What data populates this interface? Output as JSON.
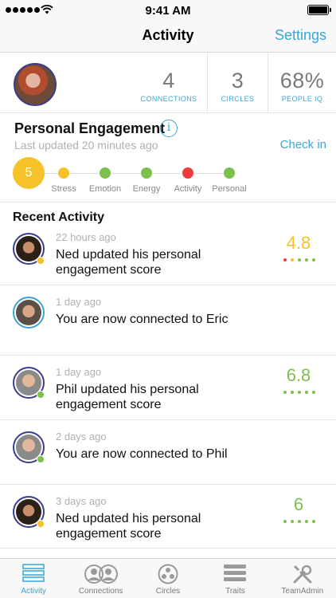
{
  "status_bar": {
    "time": "9:41 AM"
  },
  "nav": {
    "title": "Activity",
    "settings_label": "Settings"
  },
  "stats": [
    {
      "value": "4",
      "label": "CONNECTIONS"
    },
    {
      "value": "3",
      "label": "CIRCLES"
    },
    {
      "value": "68%",
      "label": "PEOPLE IQ"
    }
  ],
  "engagement": {
    "title": "Personal Engagement",
    "info_icon": "i",
    "updated": "Last updated 20 minutes ago",
    "check_in": "Check in",
    "score": "5",
    "score_color": "#f5c229",
    "metrics": [
      {
        "label": "Stress",
        "color": "#f5c229"
      },
      {
        "label": "Emotion",
        "color": "#7cc04b"
      },
      {
        "label": "Energy",
        "color": "#7cc04b"
      },
      {
        "label": "Activity",
        "color": "#ee3b3b"
      },
      {
        "label": "Personal",
        "color": "#7cc04b"
      }
    ]
  },
  "recent": {
    "title": "Recent Activity",
    "items": [
      {
        "time": "22 hours ago",
        "text": "Ned updated his personal engagement score",
        "score": "4.8",
        "score_color": "#f5c229",
        "status_color": "#f5c229",
        "dot_colors": [
          "#ee3b3b",
          "#f5c229",
          "#7cc04b",
          "#7cc04b",
          "#7cc04b"
        ]
      },
      {
        "time": "1 day ago",
        "text": "You are now connected to Eric",
        "score": "",
        "score_color": "",
        "status_color": "",
        "dot_colors": []
      },
      {
        "time": "1 day ago",
        "text": "Phil updated his personal engagement score",
        "score": "6.8",
        "score_color": "#7cc04b",
        "status_color": "#7cc04b",
        "dot_colors": [
          "#7cc04b",
          "#7cc04b",
          "#7cc04b",
          "#7cc04b",
          "#7cc04b"
        ]
      },
      {
        "time": "2 days ago",
        "text": "You are now connected to Phil",
        "score": "",
        "score_color": "",
        "status_color": "#7cc04b",
        "dot_colors": []
      },
      {
        "time": "3 days ago",
        "text": "Ned updated his personal engagement score",
        "score": "6",
        "score_color": "#7cc04b",
        "status_color": "#f5c229",
        "dot_colors": [
          "#7cc04b",
          "#7cc04b",
          "#7cc04b",
          "#7cc04b",
          "#7cc04b"
        ]
      }
    ]
  },
  "tabs": [
    {
      "label": "Activity",
      "icon": "activity-icon",
      "active": true
    },
    {
      "label": "Connections",
      "icon": "connections-icon",
      "active": false
    },
    {
      "label": "Circles",
      "icon": "circles-icon",
      "active": false
    },
    {
      "label": "Traits",
      "icon": "traits-icon",
      "active": false
    },
    {
      "label": "TeamAdmin",
      "icon": "team-admin-icon",
      "active": false
    }
  ],
  "colors": {
    "accent": "#3aa6d4",
    "avatar_ring": "#3a3d8c"
  }
}
